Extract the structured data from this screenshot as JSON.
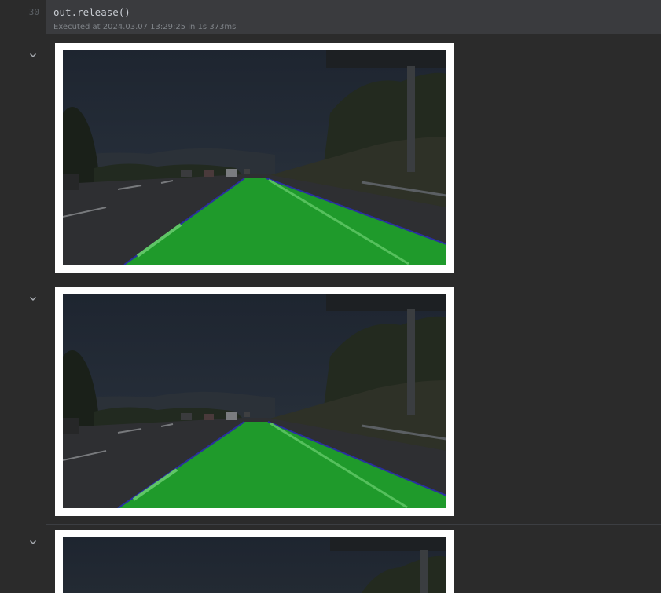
{
  "editor": {
    "line_number": "30",
    "code": "out.release()",
    "exec_status": "Executed at 2024.03.07 13:29:25 in 1s 373ms"
  },
  "outputs": [
    {
      "icon": "chevron-down-icon",
      "image": "lane-detection-frame"
    },
    {
      "icon": "chevron-down-icon",
      "image": "lane-detection-frame"
    },
    {
      "icon": "chevron-down-icon",
      "image": "lane-detection-frame"
    }
  ],
  "colors": {
    "background": "#2b2b2b",
    "code_background": "#3a3b3e",
    "lane_fill": "#1f9a2b",
    "lane_edge": "#2a2fa0"
  }
}
